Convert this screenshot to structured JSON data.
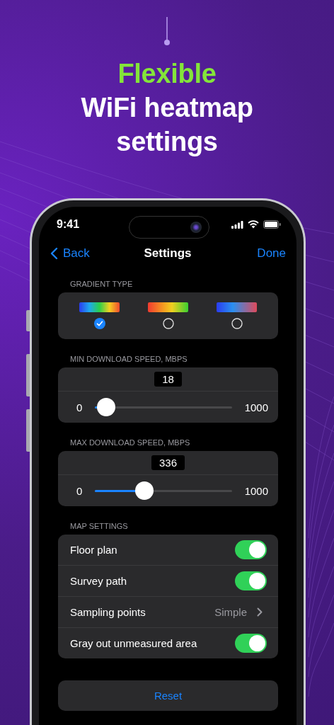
{
  "headline": {
    "accent": "Flexible",
    "lines": [
      "WiFi heatmap",
      "settings"
    ]
  },
  "status_bar": {
    "time": "9:41"
  },
  "nav": {
    "back": "Back",
    "title": "Settings",
    "done": "Done"
  },
  "gradient_type": {
    "label": "GRADIENT TYPE",
    "options": [
      {
        "kind": "spectrum",
        "selected": true
      },
      {
        "kind": "red-green",
        "selected": false
      },
      {
        "kind": "blue-red",
        "selected": false
      }
    ]
  },
  "sliders": [
    {
      "label": "MIN DOWNLOAD SPEED, MBPS",
      "value": "18",
      "min": "0",
      "max": "1000",
      "level": 0.018
    },
    {
      "label": "MAX DOWNLOAD SPEED, MBPS",
      "value": "336",
      "min": "0",
      "max": "1000",
      "level": 0.336
    }
  ],
  "map_settings": {
    "label": "MAP SETTINGS",
    "rows": [
      {
        "kind": "toggle",
        "label": "Floor plan",
        "on": true
      },
      {
        "kind": "toggle",
        "label": "Survey path",
        "on": true
      },
      {
        "kind": "choice",
        "label": "Sampling points",
        "value": "Simple"
      },
      {
        "kind": "toggle",
        "label": "Gray out unmeasured area",
        "on": true
      }
    ]
  },
  "reset": "Reset"
}
